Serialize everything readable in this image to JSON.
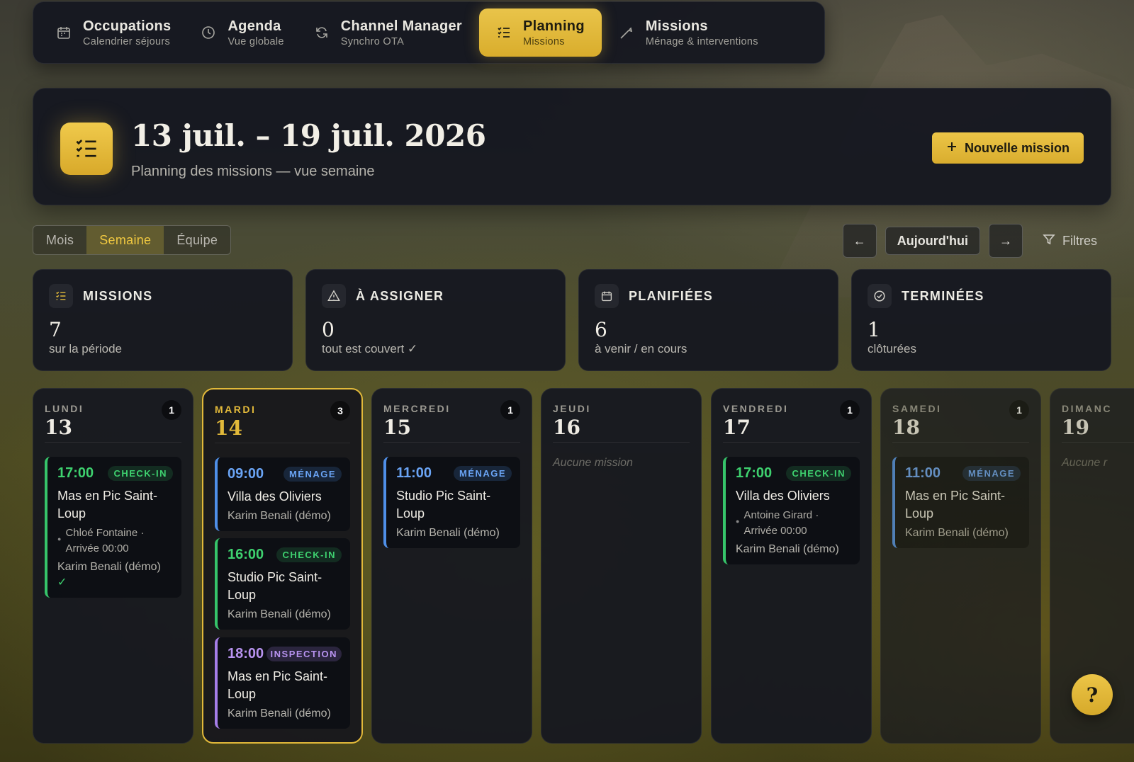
{
  "nav": {
    "items": [
      {
        "title": "Occupations",
        "subtitle": "Calendrier séjours",
        "icon": "calendar-icon"
      },
      {
        "title": "Agenda",
        "subtitle": "Vue globale",
        "icon": "clock-icon"
      },
      {
        "title": "Channel Manager",
        "subtitle": "Synchro OTA",
        "icon": "sync-icon"
      },
      {
        "title": "Planning",
        "subtitle": "Missions",
        "icon": "checklist-icon",
        "active": true
      },
      {
        "title": "Missions",
        "subtitle": "Ménage & interventions",
        "icon": "tool-icon"
      }
    ]
  },
  "hero": {
    "title": "13 juil. – 19 juil. 2026",
    "subtitle": "Planning des missions — vue semaine",
    "new_button": "Nouvelle mission"
  },
  "views": {
    "items": [
      "Mois",
      "Semaine",
      "Équipe"
    ],
    "active": "Semaine"
  },
  "toolbar": {
    "prev": "←",
    "today": "Aujourd'hui",
    "next": "→",
    "filters": "Filtres"
  },
  "stats": [
    {
      "label": "MISSIONS",
      "value": "7",
      "sub": "sur la période",
      "icon": "checklist-icon"
    },
    {
      "label": "À ASSIGNER",
      "value": "0",
      "sub": "tout est couvert ✓",
      "icon": "warning-icon"
    },
    {
      "label": "PLANIFIÉES",
      "value": "6",
      "sub": "à venir / en cours",
      "icon": "calendar-icon"
    },
    {
      "label": "TERMINÉES",
      "value": "1",
      "sub": "clôturées",
      "icon": "check-circle-icon"
    }
  ],
  "days": [
    {
      "name": "LUNDI",
      "num": "13",
      "count": "1",
      "missions": [
        {
          "time": "17:00",
          "type": "CHECK-IN",
          "title": "Mas en Pic Saint-Loup",
          "guest": "Chloé Fontaine · Arrivée 00:00",
          "staff": "Karim Benali (démo)",
          "check": "✓"
        }
      ]
    },
    {
      "name": "MARDI",
      "num": "14",
      "count": "3",
      "missions": [
        {
          "time": "09:00",
          "type": "MÉNAGE",
          "title": "Villa des Oliviers",
          "staff": "Karim Benali (démo)"
        },
        {
          "time": "16:00",
          "type": "CHECK-IN",
          "title": "Studio Pic Saint-Loup",
          "staff": "Karim Benali (démo)"
        },
        {
          "time": "18:00",
          "type": "INSPECTION",
          "title": "Mas en Pic Saint-Loup",
          "staff": "Karim Benali (démo)"
        }
      ]
    },
    {
      "name": "MERCREDI",
      "num": "15",
      "count": "1",
      "missions": [
        {
          "time": "11:00",
          "type": "MÉNAGE",
          "title": "Studio Pic Saint-Loup",
          "staff": "Karim Benali (démo)"
        }
      ]
    },
    {
      "name": "JEUDI",
      "num": "16",
      "empty": "Aucune mission"
    },
    {
      "name": "VENDREDI",
      "num": "17",
      "count": "1",
      "missions": [
        {
          "time": "17:00",
          "type": "CHECK-IN",
          "title": "Villa des Oliviers",
          "guest": "Antoine Girard · Arrivée 00:00",
          "staff": "Karim Benali (démo)"
        }
      ]
    },
    {
      "name": "SAMEDI",
      "num": "18",
      "count": "1",
      "missions": [
        {
          "time": "11:00",
          "type": "MÉNAGE",
          "title": "Mas en Pic Saint-Loup",
          "staff": "Karim Benali (démo)"
        }
      ]
    },
    {
      "name": "DIMANC",
      "num": "19",
      "empty": "Aucune r"
    }
  ],
  "help": "?",
  "colors": {
    "accent": "#e2b93a",
    "checkin": "#3ed16f",
    "menage": "#6aa4f5",
    "inspection": "#b893f0"
  }
}
